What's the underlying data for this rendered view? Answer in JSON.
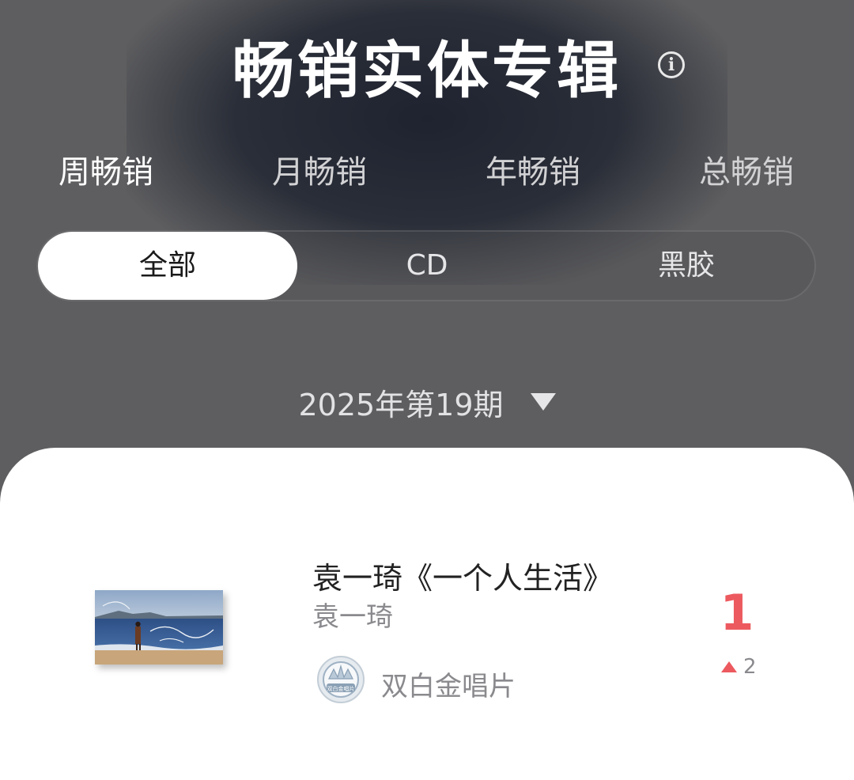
{
  "header": {
    "title": "畅销实体专辑",
    "info_icon": "info-icon"
  },
  "period_tabs": [
    {
      "label": "周畅销",
      "active": true
    },
    {
      "label": "月畅销",
      "active": false
    },
    {
      "label": "年畅销",
      "active": false
    },
    {
      "label": "总畅销",
      "active": false
    }
  ],
  "format_filter": {
    "options": [
      {
        "label": "全部",
        "selected": true
      },
      {
        "label": "CD",
        "selected": false
      },
      {
        "label": "黑胶",
        "selected": false
      }
    ]
  },
  "issue_selector": {
    "label": "2025年第19期",
    "icon": "caret-down-icon"
  },
  "list": {
    "items": [
      {
        "title": "袁一琦《一个人生活》",
        "artist": "袁一琦",
        "certification": "双白金唱片",
        "certification_badge_text": "双白金唱片",
        "rank": "1",
        "rank_change": "2",
        "rank_change_direction": "up"
      }
    ]
  },
  "colors": {
    "background": "#5e5e60",
    "accent_rank": "#ec5a5f",
    "card": "#ffffff"
  }
}
